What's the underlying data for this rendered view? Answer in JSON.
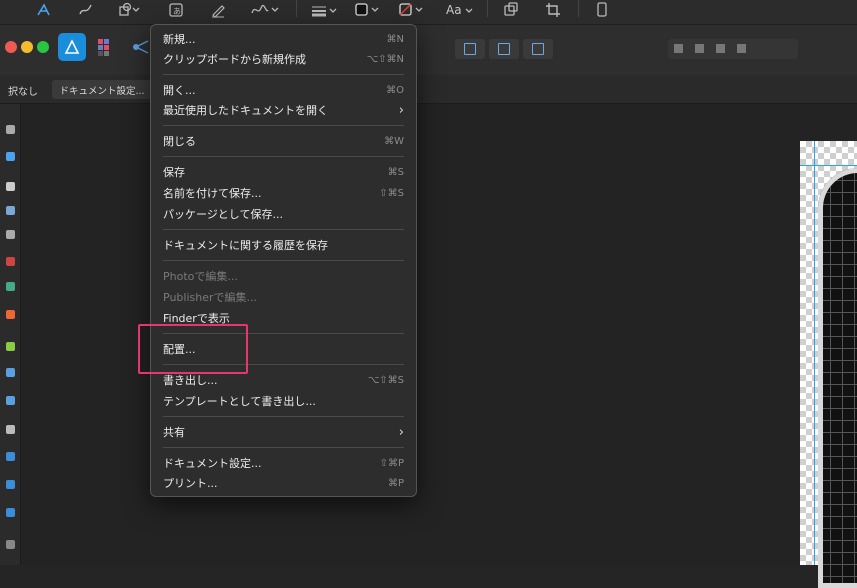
{
  "toolbar": {
    "icons": [
      "affinity-pen-icon",
      "pencil-icon",
      "shapes-icon",
      "text-frame-icon",
      "brush-icon",
      "signature-icon",
      "stroke-width-icon",
      "fill-color-icon",
      "stroke-color-icon",
      "font-icon",
      "snapping-icon",
      "crop-icon",
      "mobile-icon"
    ],
    "font_label": "Aa"
  },
  "context": {
    "selection_label": "択なし",
    "doc_settings_button": "ドキュメント設定..."
  },
  "colors": {
    "accent": "#1a8ddb",
    "highlight": "#e8356b",
    "guide": "#2aa6e6"
  },
  "menu": {
    "items": [
      {
        "label": "新規...",
        "shortcut": "⌘N"
      },
      {
        "label": "クリップボードから新規作成",
        "shortcut": "⌥⇧⌘N"
      },
      {
        "label": "開く...",
        "shortcut": "⌘O"
      },
      {
        "label": "最近使用したドキュメントを開く",
        "shortcut": "›"
      },
      {
        "label": "閉じる",
        "shortcut": "⌘W"
      },
      {
        "label": "保存",
        "shortcut": "⌘S"
      },
      {
        "label": "名前を付けて保存...",
        "shortcut": "⇧⌘S"
      },
      {
        "label": "パッケージとして保存...",
        "shortcut": ""
      },
      {
        "label": "ドキュメントに関する履歴を保存",
        "shortcut": ""
      },
      {
        "label": "Photoで編集...",
        "shortcut": ""
      },
      {
        "label": "Publisherで編集...",
        "shortcut": ""
      },
      {
        "label": "Finderで表示",
        "shortcut": ""
      },
      {
        "label": "配置...",
        "shortcut": ""
      },
      {
        "label": "書き出し...",
        "shortcut": "⌥⇧⌘S"
      },
      {
        "label": "テンプレートとして書き出し...",
        "shortcut": ""
      },
      {
        "label": "共有",
        "shortcut": "›"
      },
      {
        "label": "ドキュメント設定...",
        "shortcut": "⇧⌘P"
      },
      {
        "label": "プリント...",
        "shortcut": "⌘P"
      }
    ]
  }
}
